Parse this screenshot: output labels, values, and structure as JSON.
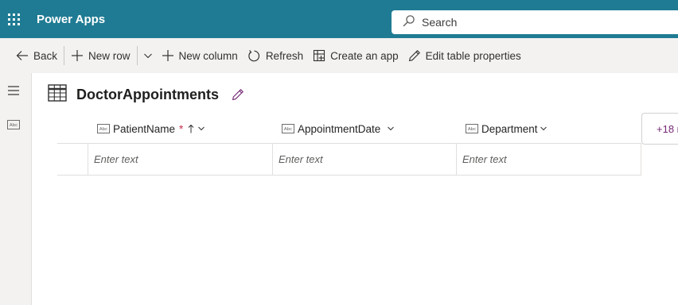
{
  "header": {
    "app_name": "Power Apps",
    "search_placeholder": "Search",
    "accent": "#1f7b93"
  },
  "toolbar": {
    "back": "Back",
    "new_row": "New row",
    "new_column": "New column",
    "refresh": "Refresh",
    "create_app": "Create an app",
    "edit_table": "Edit table properties"
  },
  "table": {
    "title": "DoctorAppointments",
    "more_columns": "+18 m",
    "columns": [
      {
        "label": "PatientName",
        "required": "*",
        "sorted": "ascending"
      },
      {
        "label": "AppointmentDate"
      },
      {
        "label": "Department"
      }
    ],
    "new_row_placeholders": [
      "Enter text",
      "Enter text",
      "Enter text"
    ]
  },
  "icons": {
    "waffle": "app-launcher-icon",
    "search": "search-icon",
    "back": "arrow-left-icon",
    "add": "plus-icon",
    "chevron": "chevron-down-icon",
    "refresh": "refresh-icon",
    "create_app": "grid-add-icon",
    "edit": "pencil-icon",
    "menu": "hamburger-icon",
    "text_field": "abc-field-icon",
    "table": "table-icon",
    "sort": "arrow-up-icon"
  }
}
